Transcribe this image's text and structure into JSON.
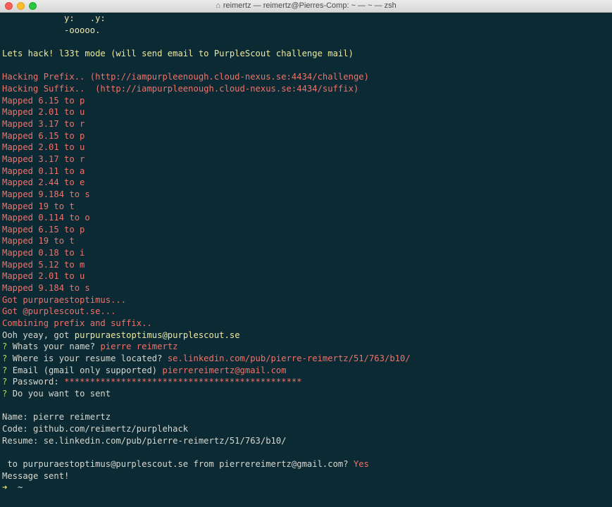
{
  "window": {
    "title": "reimertz — reimertz@Pierres-Comp: ~ — ~ — zsh"
  },
  "terminal": {
    "lines": [
      [
        {
          "t": "            y:   .y:",
          "c": "sand"
        }
      ],
      [
        {
          "t": "            -ooooo.",
          "c": "sand"
        }
      ],
      [
        {
          "t": "",
          "c": "default"
        }
      ],
      [
        {
          "t": "Lets hack! l33t mode (will send email to PurpleScout challenge mail)",
          "c": "yellow"
        }
      ],
      [
        {
          "t": "",
          "c": "default"
        }
      ],
      [
        {
          "t": "Hacking Prefix.. (http://iampurpleenough.cloud-nexus.se:4434/challenge)",
          "c": "red"
        }
      ],
      [
        {
          "t": "Hacking Suffix..  (http://iampurpleenough.cloud-nexus.se:4434/suffix)",
          "c": "red"
        }
      ],
      [
        {
          "t": "Mapped 6.15 to p",
          "c": "red"
        }
      ],
      [
        {
          "t": "Mapped 2.01 to u",
          "c": "red"
        }
      ],
      [
        {
          "t": "Mapped 3.17 to r",
          "c": "red"
        }
      ],
      [
        {
          "t": "Mapped 6.15 to p",
          "c": "red"
        }
      ],
      [
        {
          "t": "Mapped 2.01 to u",
          "c": "red"
        }
      ],
      [
        {
          "t": "Mapped 3.17 to r",
          "c": "red"
        }
      ],
      [
        {
          "t": "Mapped 0.11 to a",
          "c": "red"
        }
      ],
      [
        {
          "t": "Mapped 2.44 to e",
          "c": "red"
        }
      ],
      [
        {
          "t": "Mapped 9.184 to s",
          "c": "red"
        }
      ],
      [
        {
          "t": "Mapped 19 to t",
          "c": "red"
        }
      ],
      [
        {
          "t": "Mapped 0.114 to o",
          "c": "red"
        }
      ],
      [
        {
          "t": "Mapped 6.15 to p",
          "c": "red"
        }
      ],
      [
        {
          "t": "Mapped 19 to t",
          "c": "red"
        }
      ],
      [
        {
          "t": "Mapped 0.18 to i",
          "c": "red"
        }
      ],
      [
        {
          "t": "Mapped 5.12 to m",
          "c": "red"
        }
      ],
      [
        {
          "t": "Mapped 2.01 to u",
          "c": "red"
        }
      ],
      [
        {
          "t": "Mapped 9.184 to s",
          "c": "red"
        }
      ],
      [
        {
          "t": "Got purpuraestoptimus...",
          "c": "red"
        }
      ],
      [
        {
          "t": "Got @purplescout.se...",
          "c": "red"
        }
      ],
      [
        {
          "t": "Combining prefix and suffix..",
          "c": "red"
        }
      ],
      [
        {
          "t": "Ooh yeay, got ",
          "c": "default"
        },
        {
          "t": "purpuraestoptimus@purplescout.se",
          "c": "yellow"
        }
      ],
      [
        {
          "t": "? ",
          "c": "green"
        },
        {
          "t": "Whats your name? ",
          "c": "default"
        },
        {
          "t": "pierre reimertz",
          "c": "red"
        }
      ],
      [
        {
          "t": "? ",
          "c": "green"
        },
        {
          "t": "Where is your resume located? ",
          "c": "default"
        },
        {
          "t": "se.linkedin.com/pub/pierre-reimertz/51/763/b10/",
          "c": "red"
        }
      ],
      [
        {
          "t": "? ",
          "c": "green"
        },
        {
          "t": "Email (gmail only supported) ",
          "c": "default"
        },
        {
          "t": "pierrereimertz@gmail.com",
          "c": "red"
        }
      ],
      [
        {
          "t": "? ",
          "c": "green"
        },
        {
          "t": "Password: ",
          "c": "default"
        },
        {
          "t": "**********************************************",
          "c": "red"
        }
      ],
      [
        {
          "t": "? ",
          "c": "green"
        },
        {
          "t": "Do you want to sent",
          "c": "default"
        }
      ],
      [
        {
          "t": "",
          "c": "default"
        }
      ],
      [
        {
          "t": "Name: pierre reimertz",
          "c": "default"
        }
      ],
      [
        {
          "t": "Code: github.com/reimertz/purplehack",
          "c": "default"
        }
      ],
      [
        {
          "t": "Resume: se.linkedin.com/pub/pierre-reimertz/51/763/b10/",
          "c": "default"
        }
      ],
      [
        {
          "t": "",
          "c": "default"
        }
      ],
      [
        {
          "t": " to purpuraestoptimus@purplescout.se from pierrereimertz@gmail.com? ",
          "c": "default"
        },
        {
          "t": "Yes",
          "c": "red"
        }
      ],
      [
        {
          "t": "Message sent!",
          "c": "default"
        }
      ],
      [
        {
          "t": "➜ ",
          "c": "arrow"
        },
        {
          "t": " ~",
          "c": "default"
        }
      ]
    ]
  }
}
